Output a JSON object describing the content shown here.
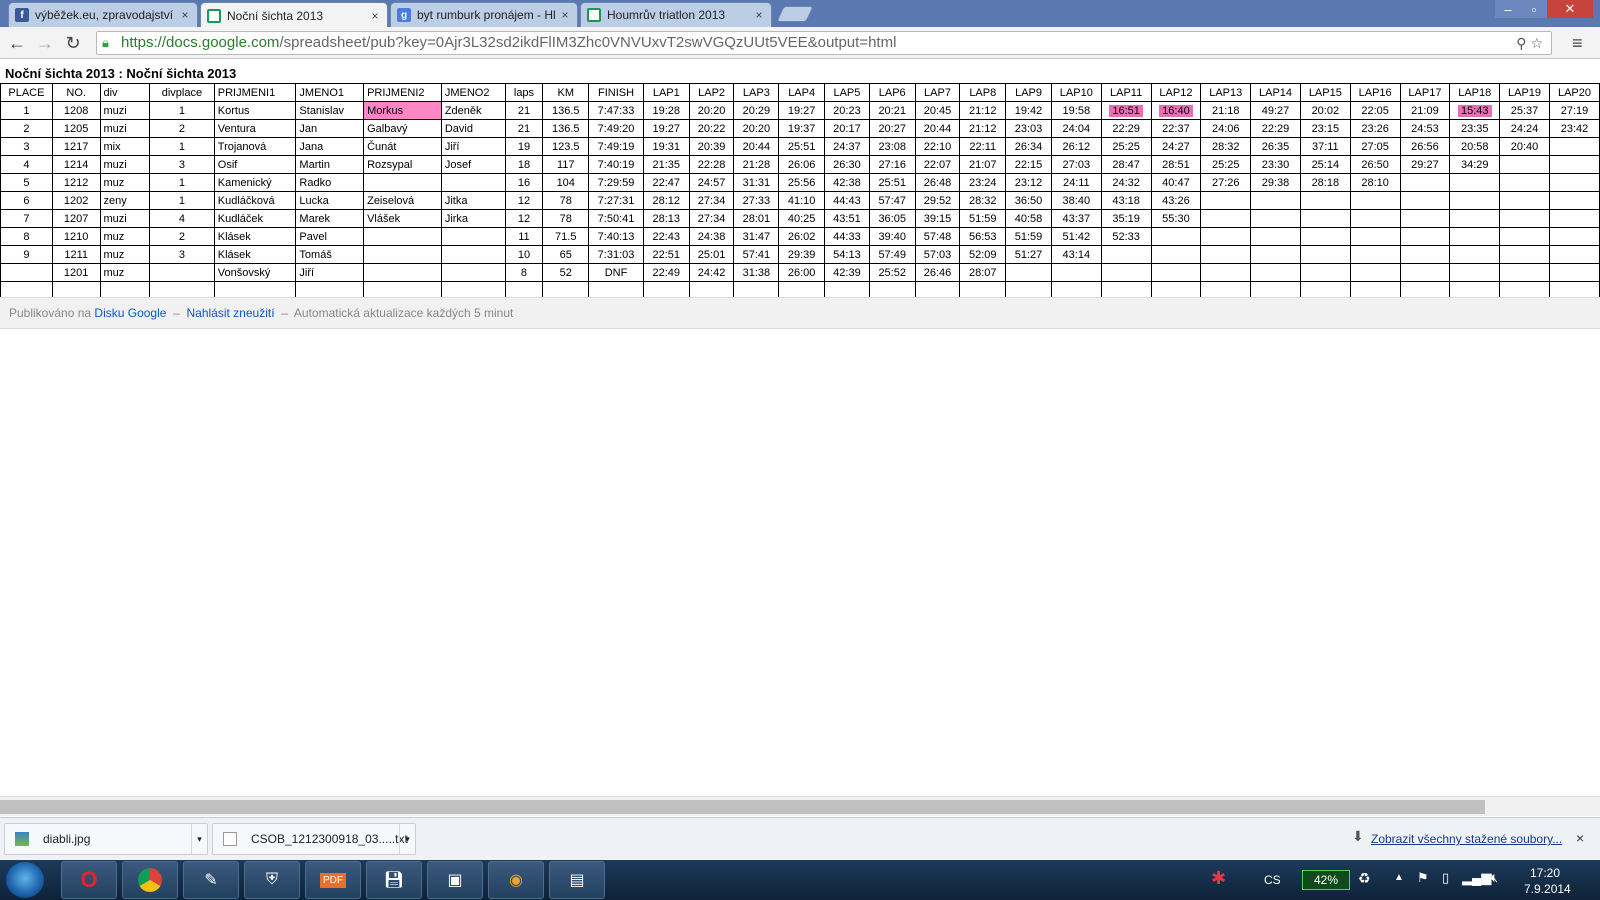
{
  "tabs": [
    {
      "label": "výběžek.eu, zpravodajství",
      "favicon": "facebook-icon",
      "active": false
    },
    {
      "label": "Noční šichta 2013",
      "favicon": "sheets-icon",
      "active": true
    },
    {
      "label": "byt rumburk pronájem - Hl",
      "favicon": "google-search-icon",
      "active": false
    },
    {
      "label": "Houmrův triatlon 2013",
      "favicon": "sheets-icon",
      "active": false
    }
  ],
  "tab_close_glyph": "×",
  "address": {
    "host": "https://docs.google.com",
    "path": "/spreadsheet/pub?key=0Ajr3L32sd2ikdFlIM3Zhc0VNVUxvT2swVGQzUUt5VEE&output=html"
  },
  "sheet_title": "Noční šichta 2013 : Noční šichta 2013",
  "table": {
    "headers": [
      "PLACE",
      "NO.",
      "div",
      "divplace",
      "PRIJMENI1",
      "JMENO1",
      "PRIJMENI2",
      "JMENO2",
      "laps",
      "KM",
      "FINISH",
      "LAP1",
      "LAP2",
      "LAP3",
      "LAP4",
      "LAP5",
      "LAP6",
      "LAP7",
      "LAP8",
      "LAP9",
      "LAP10",
      "LAP11",
      "LAP12",
      "LAP13",
      "LAP14",
      "LAP15",
      "LAP16",
      "LAP17",
      "LAP18",
      "LAP19",
      "LAP20"
    ],
    "rows": [
      [
        "1",
        "1208",
        "muzi",
        "1",
        "Kortus",
        "Stanislav",
        "Morkus",
        "Zdeněk",
        "21",
        "136.5",
        "7:47:33",
        "19:28",
        "20:20",
        "20:29",
        "19:27",
        "20:23",
        "20:21",
        "20:45",
        "21:12",
        "19:42",
        "19:58",
        "16:51",
        "16:40",
        "21:18",
        "49:27",
        "20:02",
        "22:05",
        "21:09",
        "15:43",
        "25:37",
        "27:19"
      ],
      [
        "2",
        "1205",
        "muzi",
        "2",
        "Ventura",
        "Jan",
        "Galbavý",
        "David",
        "21",
        "136.5",
        "7:49:20",
        "19:27",
        "20:22",
        "20:20",
        "19:37",
        "20:17",
        "20:27",
        "20:44",
        "21:12",
        "23:03",
        "24:04",
        "22:29",
        "22:37",
        "24:06",
        "22:29",
        "23:15",
        "23:26",
        "24:53",
        "23:35",
        "24:24",
        "23:42"
      ],
      [
        "3",
        "1217",
        "mix",
        "1",
        "Trojanová",
        "Jana",
        "Čunát",
        "Jiří",
        "19",
        "123.5",
        "7:49:19",
        "19:31",
        "20:39",
        "20:44",
        "25:51",
        "24:37",
        "23:08",
        "22:10",
        "22:11",
        "26:34",
        "26:12",
        "25:25",
        "24:27",
        "28:32",
        "26:35",
        "37:11",
        "27:05",
        "26:56",
        "20:58",
        "20:40",
        ""
      ],
      [
        "4",
        "1214",
        "muzi",
        "3",
        "Osif",
        "Martin",
        "Rozsypal",
        "Josef",
        "18",
        "117",
        "7:40:19",
        "21:35",
        "22:28",
        "21:28",
        "26:06",
        "26:30",
        "27:16",
        "22:07",
        "21:07",
        "22:15",
        "27:03",
        "28:47",
        "28:51",
        "25:25",
        "23:30",
        "25:14",
        "26:50",
        "29:27",
        "34:29",
        "",
        ""
      ],
      [
        "5",
        "1212",
        "muz",
        "1",
        "Kamenický",
        "Radko",
        "",
        "",
        "16",
        "104",
        "7:29:59",
        "22:47",
        "24:57",
        "31:31",
        "25:56",
        "42:38",
        "25:51",
        "26:48",
        "23:24",
        "23:12",
        "24:11",
        "24:32",
        "40:47",
        "27:26",
        "29:38",
        "28:18",
        "28:10",
        "",
        "",
        "",
        ""
      ],
      [
        "6",
        "1202",
        "zeny",
        "1",
        "Kudláčková",
        "Lucka",
        "Zeiselová",
        "Jitka",
        "12",
        "78",
        "7:27:31",
        "28:12",
        "27:34",
        "27:33",
        "41:10",
        "44:43",
        "57:47",
        "29:52",
        "28:32",
        "36:50",
        "38:40",
        "43:18",
        "43:26",
        "",
        "",
        "",
        "",
        "",
        "",
        "",
        ""
      ],
      [
        "7",
        "1207",
        "muzi",
        "4",
        "Kudláček",
        "Marek",
        "Vlášek",
        "Jirka",
        "12",
        "78",
        "7:50:41",
        "28:13",
        "27:34",
        "28:01",
        "40:25",
        "43:51",
        "36:05",
        "39:15",
        "51:59",
        "40:58",
        "43:37",
        "35:19",
        "55:30",
        "",
        "",
        "",
        "",
        "",
        "",
        "",
        ""
      ],
      [
        "8",
        "1210",
        "muz",
        "2",
        "Klásek",
        "Pavel",
        "",
        "",
        "11",
        "71.5",
        "7:40:13",
        "22:43",
        "24:38",
        "31:47",
        "26:02",
        "44:33",
        "39:40",
        "57:48",
        "56:53",
        "51:59",
        "51:42",
        "52:33",
        "",
        "",
        "",
        "",
        "",
        "",
        "",
        "",
        ""
      ],
      [
        "9",
        "1211",
        "muz",
        "3",
        "Klásek",
        "Tomáš",
        "",
        "",
        "10",
        "65",
        "7:31:03",
        "22:51",
        "25:01",
        "57:41",
        "29:39",
        "54:13",
        "57:49",
        "57:03",
        "52:09",
        "51:27",
        "43:14",
        "",
        "",
        "",
        "",
        "",
        "",
        "",
        "",
        "",
        ""
      ],
      [
        "",
        "1201",
        "muz",
        "",
        "Vonšovský",
        "Jiří",
        "",
        "",
        "8",
        "52",
        "DNF",
        "22:49",
        "24:42",
        "31:38",
        "26:00",
        "42:39",
        "25:52",
        "26:46",
        "28:07",
        "",
        "",
        "",
        "",
        "",
        "",
        "",
        "",
        "",
        "",
        "",
        ""
      ]
    ],
    "highlight_color": "#ff86c6"
  },
  "footer": {
    "published_prefix": "Publikováno na",
    "published_link": "Disku Google",
    "sep1": "–",
    "report_link": "Nahlásit zneužití",
    "sep2": "–",
    "autoupdate": "Automatická aktualizace každých 5 minut"
  },
  "downloads": {
    "items": [
      "diabli.jpg",
      "CSOB_1212300918_03.....txt"
    ],
    "show_all": "Zobrazit všechny stažené soubory...",
    "close_glyph": "×"
  },
  "taskbar": {
    "lang": "CS",
    "battery": "42%",
    "time": "17:20",
    "date": "7.9.2014"
  }
}
